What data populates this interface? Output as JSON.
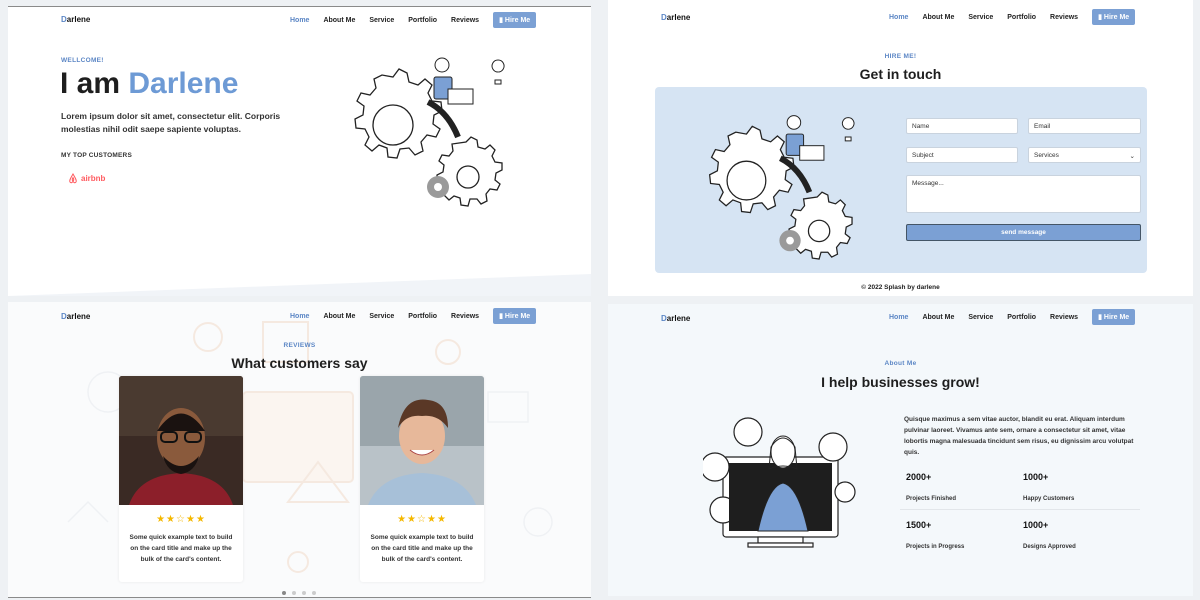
{
  "brand": {
    "logo_initial": "D",
    "logo_rest": "arlene"
  },
  "nav": {
    "items": [
      "Home",
      "About Me",
      "Service",
      "Portfolio",
      "Reviews"
    ],
    "hire_label": "Hire Me"
  },
  "hero": {
    "welcome": "WELLCOME!",
    "title_prefix": "I am ",
    "title_name": "Darlene",
    "lead": "Lorem ipsum dolor sit amet, consectetur elit. Corporis molestias nihil odit saepe sapiente voluptas.",
    "customers_heading": "MY TOP CUSTOMERS",
    "customer_logo": "airbnb"
  },
  "contact": {
    "eyebrow": "HIRE ME!",
    "title": "Get in touch",
    "name_placeholder": "Name",
    "email_placeholder": "Email",
    "subject_placeholder": "Subject",
    "service_selected": "Services",
    "message_placeholder": "Message...",
    "send_label": "send message",
    "footer": "© 2022 Splash by darlene"
  },
  "reviews": {
    "eyebrow": "REVIEWS",
    "title": "What customers say",
    "cards": [
      {
        "stars": "★★☆★★",
        "text": "Some quick example text to build on the card title and make up the bulk of the card's content."
      },
      {
        "stars": "★★☆★★",
        "text": "Some quick example text to build on the card title and make up the bulk of the card's content."
      }
    ]
  },
  "about": {
    "eyebrow": "About Me",
    "title": "I help businesses grow!",
    "text": "Quisque maximus a sem vitae auctor, blandit eu erat. Aliquam interdum pulvinar laoreet. Vivamus ante sem, ornare a consectetur sit amet, vitae lobortis magna malesuada tincidunt sem risus, eu dignissim arcu volutpat quis.",
    "stats": [
      {
        "value": "2000+",
        "label": "Projects Finished"
      },
      {
        "value": "1000+",
        "label": "Happy Customers"
      },
      {
        "value": "1500+",
        "label": "Projects in Progress"
      },
      {
        "value": "1000+",
        "label": "Designs Approved"
      }
    ]
  },
  "colors": {
    "accent": "#5b86c5",
    "button": "#7ba0d4",
    "contact_bg": "#d6e4f3",
    "star": "#f5b800",
    "airbnb": "#ff5a5f"
  }
}
